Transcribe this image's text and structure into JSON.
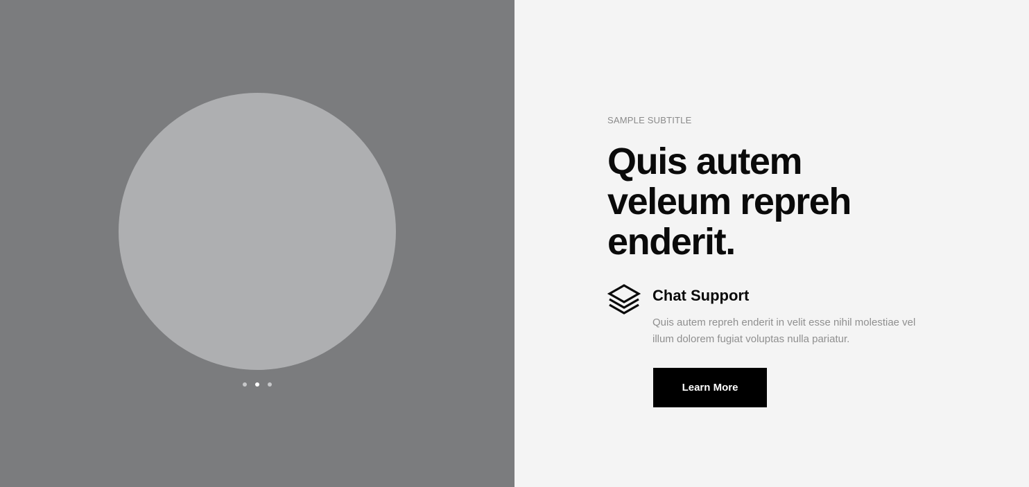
{
  "slider": {
    "dots_count": 3,
    "active_dot": 2
  },
  "content": {
    "subtitle": "SAMPLE SUBTITLE",
    "headline": "Quis autem veleum repreh enderit.",
    "feature": {
      "icon": "layers-icon",
      "title": "Chat Support",
      "description": "Quis autem repreh enderit in velit esse nihil molestiae vel illum dolorem fugiat voluptas nulla pariatur."
    },
    "button_label": "Learn More"
  },
  "colors": {
    "left_background": "#7b7c7e",
    "circle": "#aeafb1",
    "right_background": "#f4f4f4",
    "button": "#000000",
    "heading": "#0a0a0a",
    "muted_text": "#8f8f8f"
  }
}
